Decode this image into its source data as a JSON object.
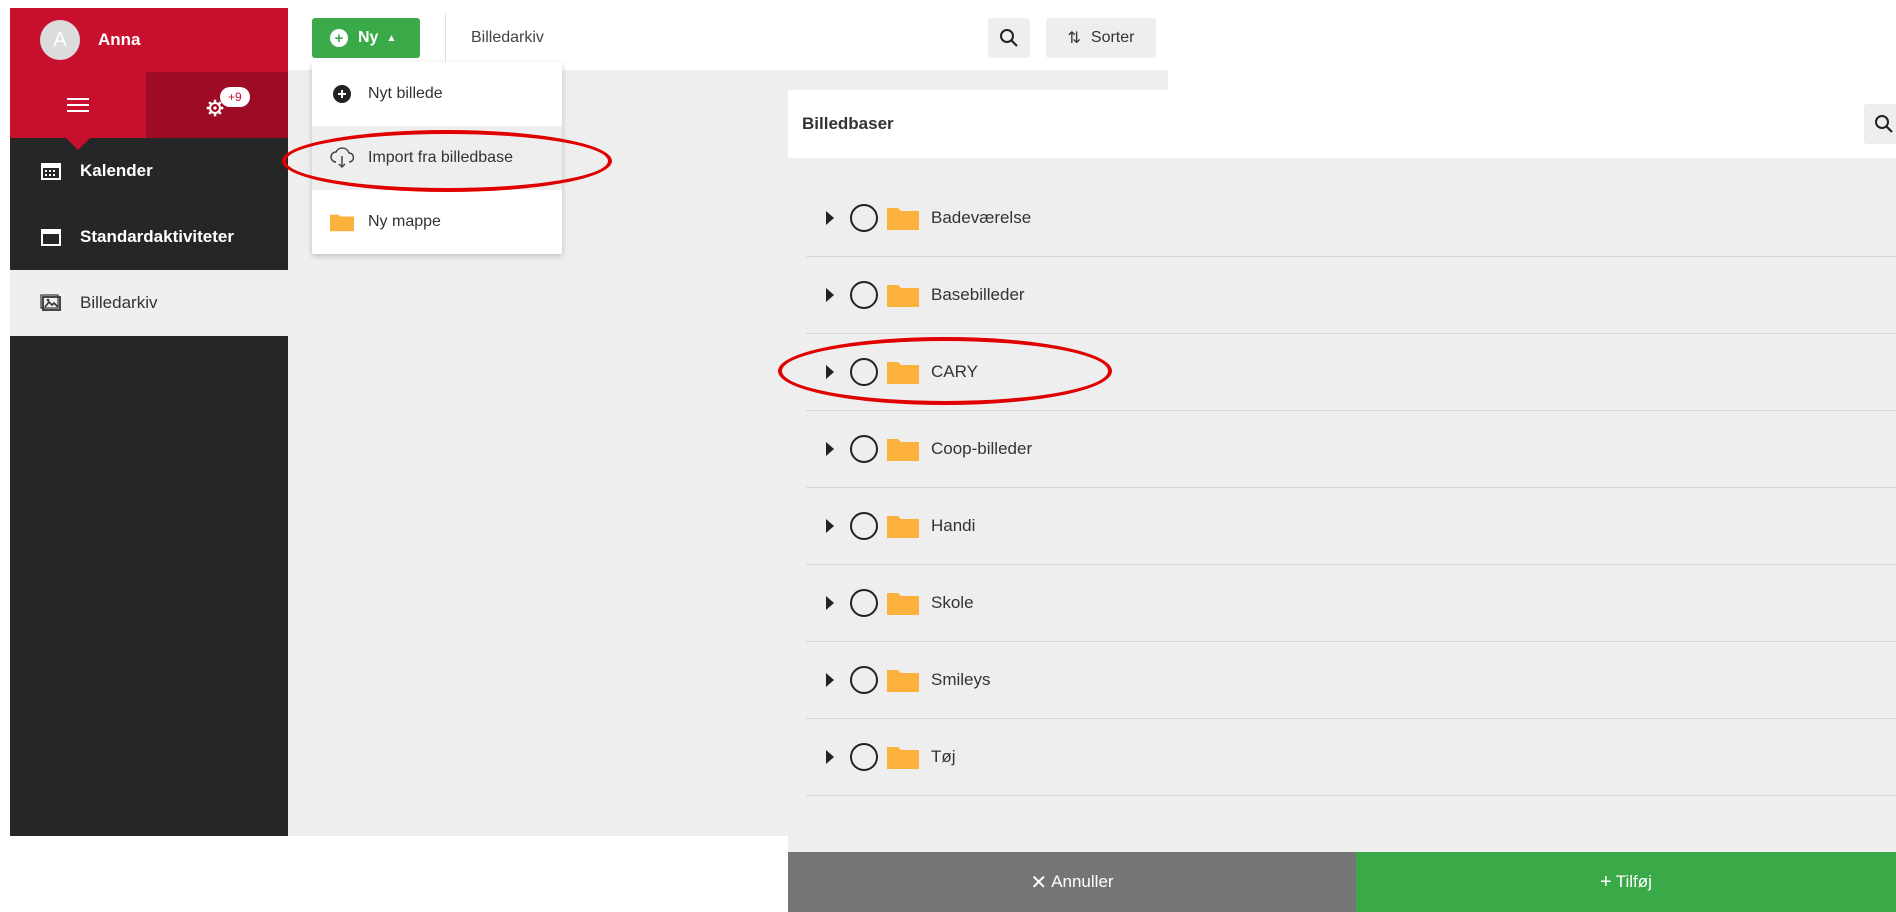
{
  "sidebar": {
    "user": {
      "initial": "A",
      "name": "Anna"
    },
    "settings_badge": "+9",
    "items": [
      {
        "label": "Kalender"
      },
      {
        "label": "Standardaktiviteter"
      },
      {
        "label": "Billedarkiv"
      }
    ],
    "active_item": "Billedarkiv"
  },
  "toolbar": {
    "new_label": "Ny",
    "breadcrumb": "Billedarkiv",
    "sort_label": "Sorter"
  },
  "dropdown": {
    "items": [
      {
        "label": "Nyt billede",
        "icon": "add-circle-icon"
      },
      {
        "label": "Import fra billedbase",
        "icon": "cloud-download-icon"
      },
      {
        "label": "Ny mappe",
        "icon": "folder-icon"
      }
    ]
  },
  "dialog": {
    "title": "Billedbaser",
    "folders": [
      {
        "label": "Badeværelse"
      },
      {
        "label": "Basebilleder"
      },
      {
        "label": "CARY"
      },
      {
        "label": "Coop-billeder"
      },
      {
        "label": "Handi"
      },
      {
        "label": "Skole"
      },
      {
        "label": "Smileys"
      },
      {
        "label": "Tøj"
      }
    ],
    "cancel_label": "Annuller",
    "add_label": "Tilføj"
  },
  "colors": {
    "brand_red": "#c8102e",
    "action_green": "#3aaa48",
    "folder_yellow": "#fbb13c",
    "annotation_red": "#e00000"
  }
}
